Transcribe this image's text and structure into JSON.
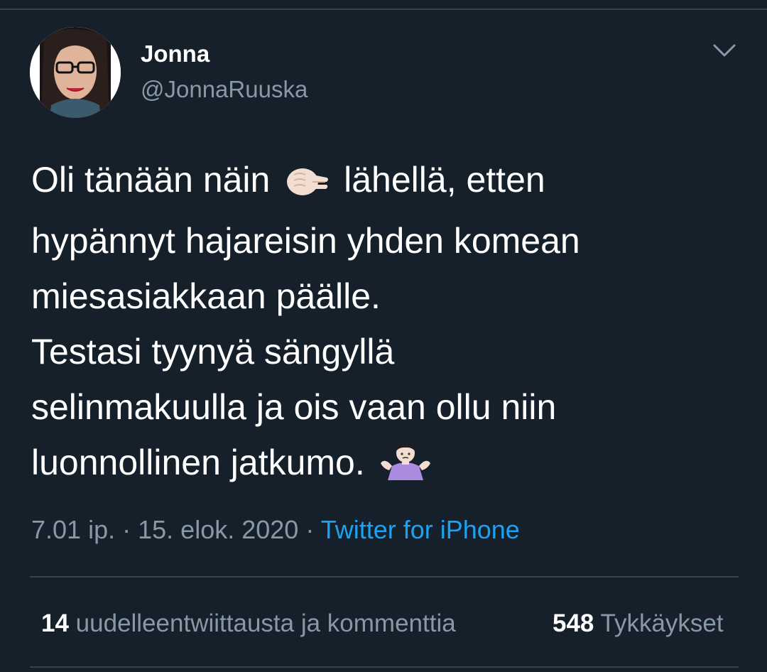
{
  "tweet": {
    "author_name": "Jonna",
    "author_handle": "@JonnaRuuska",
    "text_lines": [
      {
        "before": "Oli tänään näin ",
        "emoji": "pinching-hand-emoji",
        "after": " lähellä, etten"
      },
      {
        "text": "hypännyt hajareisin yhden komean"
      },
      {
        "text": "miesasiakkaan päälle."
      },
      {
        "text": "Testasi tyynyä sängyllä"
      },
      {
        "text": "selinmakuulla ja ois vaan ollu niin"
      },
      {
        "before": "luonnollinen jatkumo. ",
        "emoji": "person-shrugging-emoji"
      }
    ],
    "time": "7.01 ip.",
    "separator": "·",
    "date": "15. elok. 2020",
    "source": "Twitter for iPhone",
    "retweets_count": "14",
    "retweets_label": "uudelleentwiittausta ja kommenttia",
    "likes_count": "548",
    "likes_label": "Tykkäykset"
  },
  "icons": {
    "menu": "chevron-down-icon"
  },
  "colors": {
    "background": "#15202b",
    "text": "#ffffff",
    "secondary_text": "#8899a6",
    "link": "#1da1f2",
    "divider": "#38444d"
  }
}
